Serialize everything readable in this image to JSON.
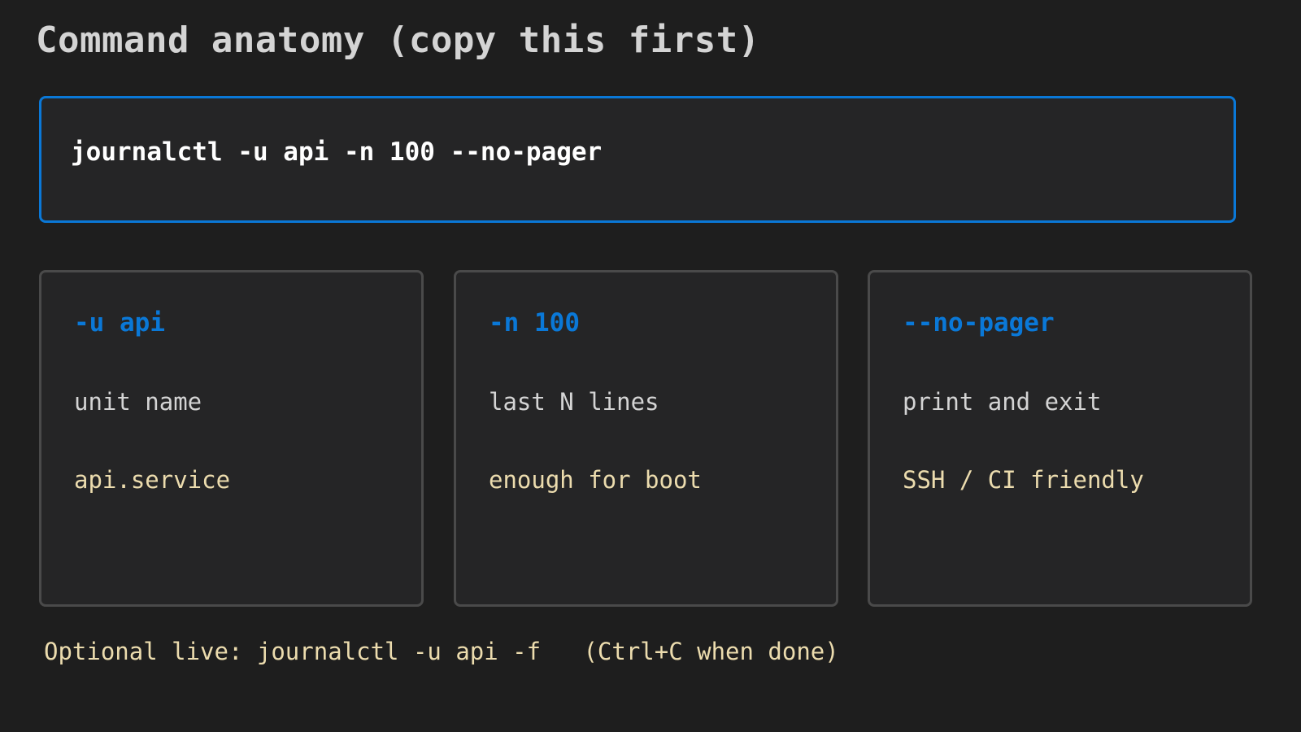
{
  "page": {
    "title": "Command anatomy (copy this first)"
  },
  "command": {
    "text": "journalctl -u api -n 100 --no-pager"
  },
  "cards": [
    {
      "flag": "-u api",
      "description": "unit name",
      "note": "api.service"
    },
    {
      "flag": "-n 100",
      "description": "last N lines",
      "note": "enough for boot"
    },
    {
      "flag": "--no-pager",
      "description": "print and exit",
      "note": "SSH / CI friendly"
    }
  ],
  "footer": {
    "text": "Optional live: journalctl -u api -f   (Ctrl+C when done)"
  },
  "colors": {
    "background": "#1e1e1e",
    "accent": "#0a78d7",
    "card_border": "#4a4a4a",
    "note_text": "#ecdcae"
  }
}
